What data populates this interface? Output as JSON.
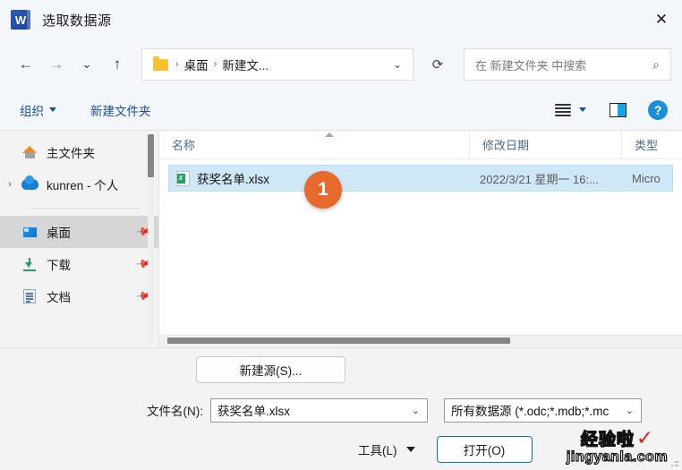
{
  "window": {
    "title": "选取数据源",
    "app_icon": "word-icon",
    "close_label": "✕"
  },
  "nav": {
    "back": "←",
    "forward": "→",
    "recent": "⌄",
    "up": "↑",
    "refresh": "⟳",
    "breadcrumb": {
      "folder_icon": "folder-icon",
      "separator": "›",
      "items": [
        "桌面",
        "新建文..."
      ]
    },
    "address_chevron": "⌄"
  },
  "search": {
    "placeholder": "在 新建文件夹 中搜索",
    "icon": "search-icon"
  },
  "commandbar": {
    "organize_label": "组织",
    "new_folder_label": "新建文件夹",
    "view_icon": "list-view-icon",
    "view_chevron": "chevron-down-icon",
    "preview_pane_icon": "preview-pane-icon",
    "help_label": "?"
  },
  "sidebar": {
    "items": [
      {
        "label": "主文件夹",
        "icon": "home-icon",
        "expander": false,
        "pinned": false,
        "selected": false
      },
      {
        "label": "kunren - 个人",
        "icon": "onedrive-cloud-icon",
        "expander": true,
        "pinned": false,
        "selected": false
      },
      {
        "label": "桌面",
        "icon": "desktop-icon",
        "expander": false,
        "pinned": true,
        "selected": true
      },
      {
        "label": "下载",
        "icon": "download-icon",
        "expander": false,
        "pinned": true,
        "selected": false
      },
      {
        "label": "文档",
        "icon": "documents-icon",
        "expander": false,
        "pinned": true,
        "selected": false
      }
    ],
    "expander_glyph": "›",
    "pin_glyph": "📌"
  },
  "filelist": {
    "columns": [
      "名称",
      "修改日期",
      "类型"
    ],
    "sort_indicator": "ascending",
    "rows": [
      {
        "name": "获奖名单.xlsx",
        "date": "2022/3/21 星期一 16:...",
        "type": "Micro",
        "icon": "excel-file-icon",
        "selected": true
      }
    ],
    "annotation_badge": "1"
  },
  "footer": {
    "new_source_label": "新建源(S)...",
    "filename_label": "文件名(N):",
    "filename_value": "获奖名单.xlsx",
    "filetype_value": "所有数据源 (*.odc;*.mdb;*.mc",
    "tools_label": "工具(L)",
    "open_label": "打开(O)"
  },
  "watermark": {
    "top": "经验啦",
    "check": "✓",
    "bottom": "jingyanla.com"
  },
  "colors": {
    "accent_blue": "#0a72bb",
    "link_blue": "#1d4f91",
    "selection_blue": "#cfe8f7",
    "badge_orange": "#e8692c",
    "excel_green": "#21a366",
    "watermark_red": "#e02020"
  }
}
